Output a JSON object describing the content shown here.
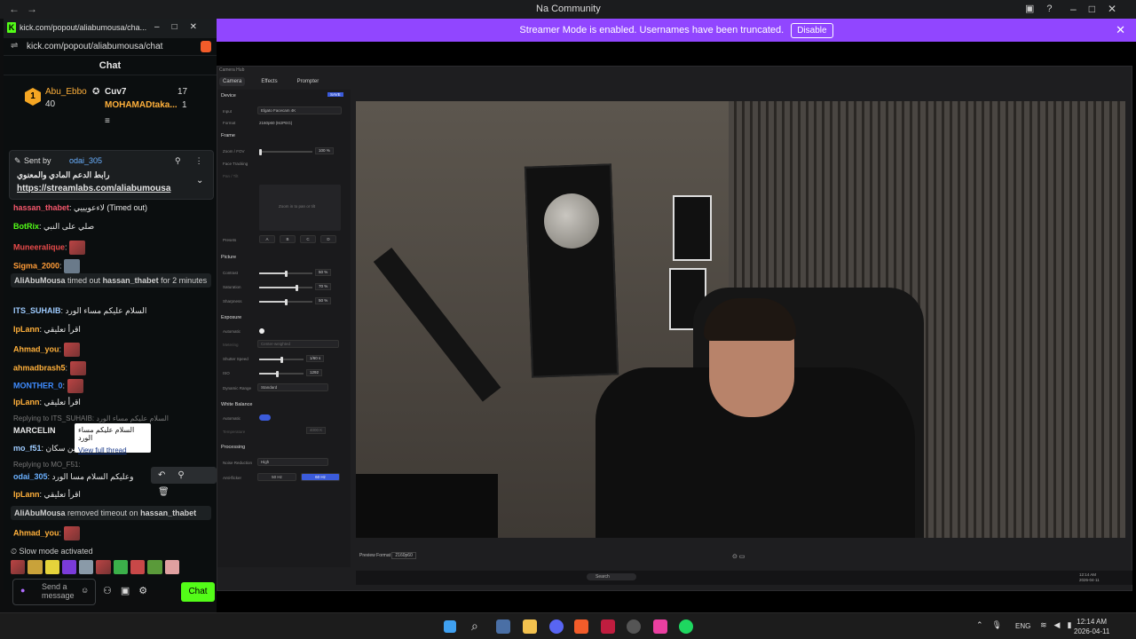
{
  "browser": {
    "title": "Na Community"
  },
  "banner": {
    "text": "Streamer Mode is enabled. Usernames have been truncated.",
    "button": "Disable"
  },
  "chat_window": {
    "title_url": "kick.com/popout/aliabumousa/cha...",
    "address": "kick.com/popout/aliabumousa/chat",
    "header": "Chat",
    "leaderboard": {
      "rank": "1",
      "first": {
        "name": "Abu_Ebbo",
        "count": "40"
      },
      "second": {
        "name": "Cuv7",
        "count": "17"
      },
      "third": {
        "name": "MOHAMADtaka...",
        "count": "1"
      }
    },
    "pinned": {
      "sent_by_label": "Sent by",
      "sender": "odai_305",
      "text": "رابط الدعم المادي والمعنوي",
      "link": "https://streamlabs.com/aliabumousa"
    },
    "messages": [
      {
        "user": "hassan_thabet",
        "text": "لاءعويييي (Timed out)",
        "color": "#f5576c"
      },
      {
        "user": "BotRix",
        "text": "صلي على النبي",
        "color": "#53fc18"
      },
      {
        "user": "Muneeralique",
        "text": "",
        "color": "#e94b4b"
      },
      {
        "user": "Sigma_2000",
        "text": "",
        "color": "#ff9c38"
      },
      {
        "user": "ITS_SUHAIB",
        "text": "السلام عليكم مساء الورد",
        "color": "#9ecbff"
      },
      {
        "user": "IpLann",
        "text": "اقرأ تعليقي",
        "color": "#ffb03b"
      },
      {
        "user": "Ahmad_you",
        "text": "",
        "color": "#ffb03b"
      },
      {
        "user": "ahmadbrash5",
        "text": "",
        "color": "#ffb03b"
      },
      {
        "user": "MONTHER_0",
        "text": "",
        "color": "#3f8cff"
      },
      {
        "user": "IpLann",
        "text": "اقرأ تعليقي",
        "color": "#ffb03b"
      },
      {
        "user": "MARCELIN",
        "text": "",
        "color": "#e8e8e8"
      },
      {
        "user": "mo_f51",
        "text": "ين سكان",
        "color": "#9ecbff"
      },
      {
        "user": "odai_305",
        "text": "وعليكم السلام مسا الورد",
        "color": "#6ab0ff"
      },
      {
        "user": "IpLann",
        "text": "اقرأ تعليقي",
        "color": "#ffb03b"
      },
      {
        "user": "Ahmad_you",
        "text": "",
        "color": "#ffb03b"
      }
    ],
    "system1": {
      "actor": "AliAbuMousa",
      "verb": "timed out",
      "target": "hassan_thabet",
      "rest": "for 2 minutes"
    },
    "system2": {
      "actor": "AliAbuMousa",
      "verb": "removed timeout on",
      "target": "hassan_thabet"
    },
    "reply1": "Replying to ITS_SUHAIB: السلام عليكم مساء الورد",
    "reply2": "Replying to MO_F51:",
    "tooltip": {
      "text": "السلام عليكم مساء الورد",
      "link": "View full thread"
    },
    "slow_mode": "Slow mode activated",
    "input_placeholder": "Send a message",
    "chat_button": "Chat"
  },
  "camera_app": {
    "title": "Camera Hub",
    "tabs": [
      "Camera",
      "Effects",
      "Prompter"
    ],
    "device": {
      "label": "Device",
      "save": "SAVE",
      "input_label": "Input",
      "input_value": "Elgato Facecam 4K",
      "format_label": "Format",
      "format_value": "2160p60 (MJPEG)"
    },
    "frame": {
      "label": "Frame",
      "zoom_label": "Zoom / FOV",
      "zoom_value": "100 %",
      "face_label": "Face Tracking",
      "pan_label": "Pan / Tilt",
      "pan_hint": "Zoom in to pan or tilt",
      "presets_label": "Presets",
      "presets": [
        "A",
        "B",
        "C",
        "D"
      ]
    },
    "picture": {
      "label": "Picture",
      "contrast_label": "Contrast",
      "contrast": "50 %",
      "saturation_label": "Saturation",
      "saturation": "70 %",
      "sharpness_label": "Sharpness",
      "sharpness": "50 %"
    },
    "exposure": {
      "label": "Exposure",
      "auto_label": "Automatic",
      "metering_label": "Metering",
      "metering_value": "Center-weighted",
      "shutter_label": "Shutter Speed",
      "shutter": "1/60 s",
      "iso_label": "ISO",
      "iso": "1292",
      "range_label": "Dynamic Range",
      "range_value": "Standard"
    },
    "white_balance": {
      "label": "White Balance",
      "auto_label": "Automatic",
      "temp_label": "Temperature",
      "temp": "4000 K"
    },
    "processing": {
      "label": "Processing",
      "noise_label": "Noise Reduction",
      "noise_value": "High",
      "antiflicker_label": "Anti-flicker",
      "opt1": "50 Hz",
      "opt2": "60 Hz"
    },
    "preview_label": "Preview Format",
    "preview_value": "2160p60"
  },
  "taskbar": {
    "lang": "ENG",
    "time": "12:14 AM",
    "date": "2026-04-11",
    "search": "Search"
  },
  "colors": {
    "kick_green": "#53fc18",
    "banner": "#9146ff"
  }
}
